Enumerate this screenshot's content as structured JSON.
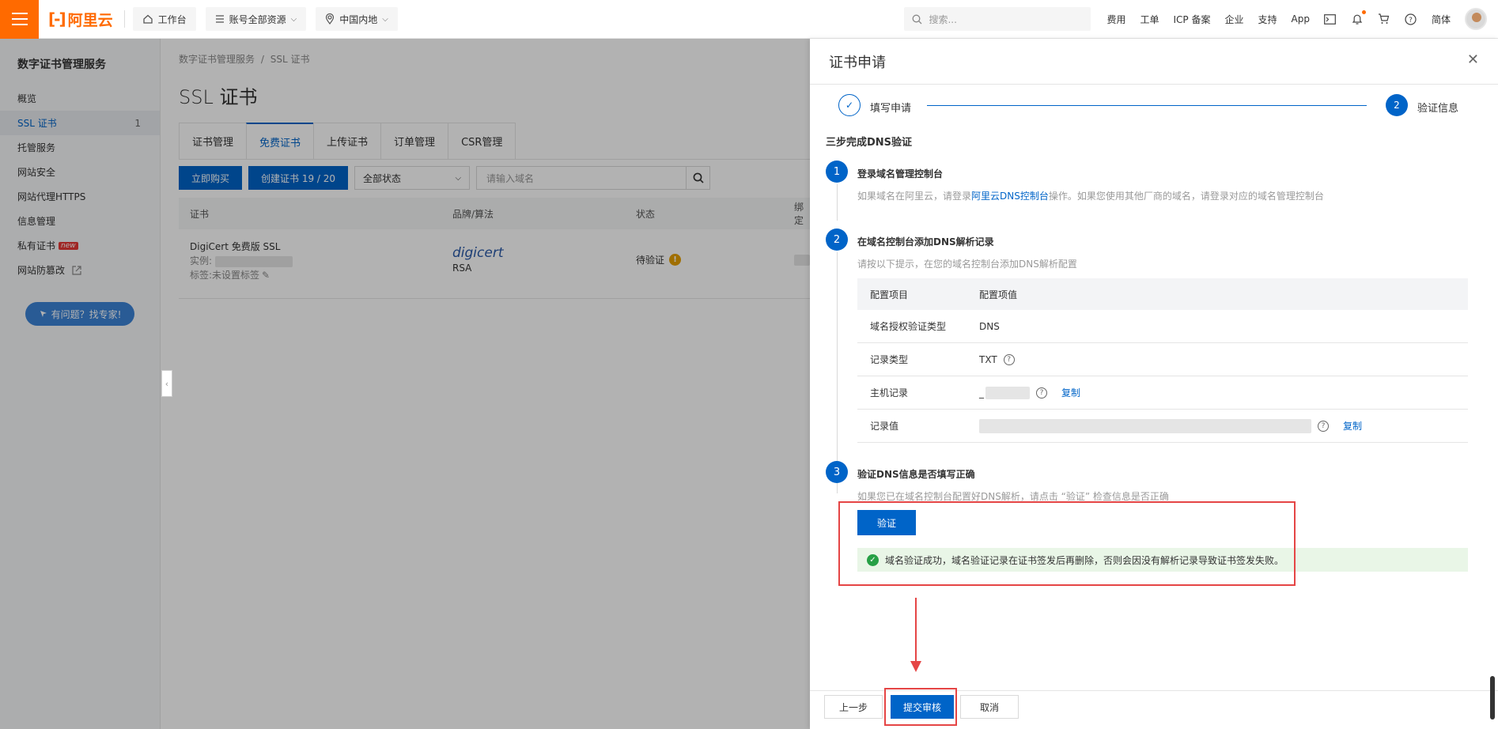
{
  "topbar": {
    "logo_text": "阿里云",
    "workbench": "工作台",
    "resources": "账号全部资源",
    "region": "中国内地",
    "search_placeholder": "搜索...",
    "links": [
      "费用",
      "工单",
      "ICP 备案",
      "企业",
      "支持",
      "App"
    ],
    "lang": "简体"
  },
  "sidebar": {
    "title": "数字证书管理服务",
    "items": [
      {
        "label": "概览"
      },
      {
        "label": "SSL 证书",
        "count": "1"
      },
      {
        "label": "托管服务"
      },
      {
        "label": "网站安全"
      },
      {
        "label": "网站代理HTTPS"
      },
      {
        "label": "信息管理"
      },
      {
        "label": "私有证书",
        "badge": "new"
      },
      {
        "label": "网站防篡改"
      }
    ],
    "expert_button": "有问题？找专家!"
  },
  "main": {
    "breadcrumb": [
      "数字证书管理服务",
      "/",
      "SSL 证书"
    ],
    "title": "SSL 证书",
    "tabs": [
      "证书管理",
      "免费证书",
      "上传证书",
      "订单管理",
      "CSR管理"
    ],
    "buy_button": "立即购买",
    "create_button": "创建证书 19 / 20",
    "status_select": "全部状态",
    "domain_placeholder": "请输入域名",
    "columns": [
      "证书",
      "品牌/算法",
      "状态",
      "绑定"
    ],
    "row": {
      "name": "DigiCert 免费版 SSL",
      "instance_label": "实例:",
      "tag": "标签:未设置标签",
      "brand": "digicert",
      "algo": "RSA",
      "status": "待验证"
    }
  },
  "drawer": {
    "title": "证书申请",
    "steps": [
      {
        "label": "填写申请"
      },
      {
        "num": "2",
        "label": "验证信息"
      }
    ],
    "heading": "三步完成DNS验证",
    "sections": [
      {
        "num": "1",
        "title": "登录域名管理控制台",
        "desc_pre": "如果域名在阿里云，请登录",
        "desc_link": "阿里云DNS控制台",
        "desc_post": "操作。如果您使用其他厂商的域名，请登录对应的域名管理控制台"
      },
      {
        "num": "2",
        "title": "在域名控制台添加DNS解析记录",
        "desc": "请按以下提示，在您的域名控制台添加DNS解析配置"
      },
      {
        "num": "3",
        "title": "验证DNS信息是否填写正确",
        "desc": "如果您已在域名控制台配置好DNS解析，请点击 “验证” 检查信息是否正确"
      }
    ],
    "config_table": {
      "headers": [
        "配置项目",
        "配置项值"
      ],
      "rows": [
        {
          "key": "域名授权验证类型",
          "value": "DNS"
        },
        {
          "key": "记录类型",
          "value": "TXT"
        },
        {
          "key": "主机记录",
          "value": "_",
          "copy": "复制"
        },
        {
          "key": "记录值",
          "value": "",
          "copy": "复制"
        }
      ]
    },
    "verify_button": "验证",
    "success_msg": "域名验证成功，域名验证记录在证书签发后再删除，否则会因没有解析记录导致证书签发失败。",
    "footer": {
      "prev": "上一步",
      "submit": "提交审核",
      "cancel": "取消"
    }
  },
  "colors": {
    "brand_orange": "#ff6a00",
    "primary_blue": "#0064c8",
    "annotation_red": "#e54545",
    "success_green": "#27a046"
  }
}
